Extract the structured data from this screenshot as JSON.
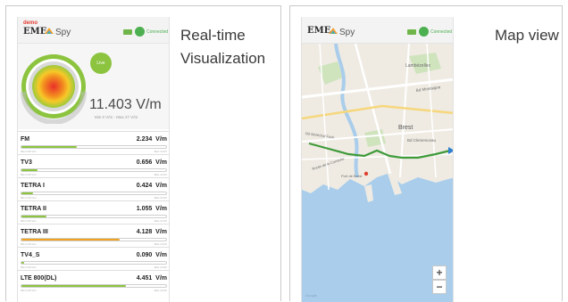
{
  "captions": {
    "left": "Real-time Visualization",
    "right": "Map view"
  },
  "app": {
    "demo_label": "demo",
    "brand_eme": "EME",
    "brand_spy": "Spy",
    "connected": "Connected"
  },
  "gauge": {
    "badge": "Live",
    "value": "11.403 V/m",
    "range": "Min 0 V/m - Max 27 V/m",
    "level": 0.42,
    "colors": [
      "#e9302a",
      "#f28a1f",
      "#f7c928",
      "#9bc93c"
    ]
  },
  "bands": [
    {
      "name": "FM",
      "value": "2.234",
      "unit": "V/m",
      "fill": 0.38,
      "color": "#8cc43f",
      "min": "Min 0.00 V/m",
      "max": "Max 4.01V"
    },
    {
      "name": "TV3",
      "value": "0.656",
      "unit": "V/m",
      "fill": 0.11,
      "color": "#8cc43f",
      "min": "Min 0.00 V/m",
      "max": "Max 4.01V"
    },
    {
      "name": "TETRA I",
      "value": "0.424",
      "unit": "V/m",
      "fill": 0.08,
      "color": "#8cc43f",
      "min": "Min 0.00 V/m",
      "max": "Max 4.01V"
    },
    {
      "name": "TETRA II",
      "value": "1.055",
      "unit": "V/m",
      "fill": 0.17,
      "color": "#8cc43f",
      "min": "Min 0.00 V/m",
      "max": "Max 4.01V"
    },
    {
      "name": "TETRA III",
      "value": "4.128",
      "unit": "V/m",
      "fill": 0.68,
      "color": "#f0a321",
      "min": "Min 0.00 V/m",
      "max": "Max 4.01V"
    },
    {
      "name": "TV4_S",
      "value": "0.090",
      "unit": "V/m",
      "fill": 0.02,
      "color": "#8cc43f",
      "min": "Min 0.00 V/m",
      "max": "Max 4.01V"
    },
    {
      "name": "LTE 800(DL)",
      "value": "4.451",
      "unit": "V/m",
      "fill": 0.72,
      "color": "#8cc43f",
      "min": "Min 0.00 V/m",
      "max": "Max 4.01V"
    }
  ],
  "map": {
    "labels": {
      "lambezellec": "Lambézellec",
      "montaigne": "Bd Montaigne",
      "brest": "Brest",
      "clemenceau": "Bd Clemenceau",
      "marechal": "Bd Maréchal Foch",
      "corniche": "Route de la Corniche",
      "port": "Port de Brest"
    },
    "zoom_in": "+",
    "zoom_out": "−",
    "attribution": "Google",
    "route_color": "#3f9a3a"
  }
}
